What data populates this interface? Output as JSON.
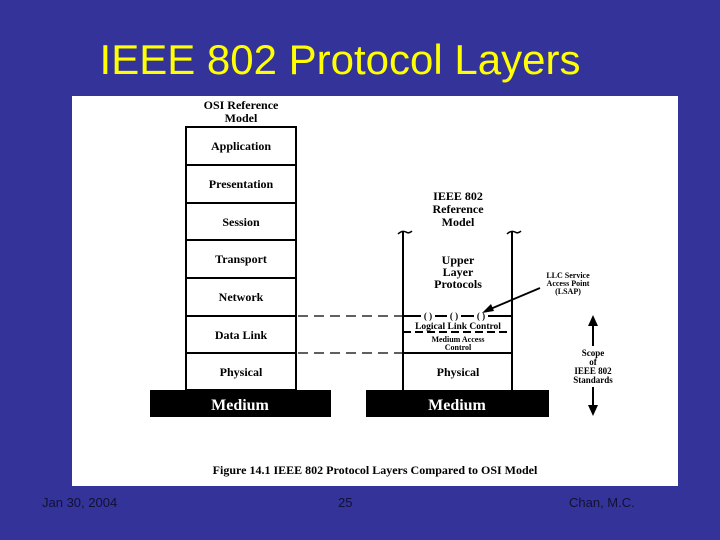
{
  "slide": {
    "title": "IEEE 802 Protocol Layers",
    "background_color": "#333399",
    "title_color": "#ffff00"
  },
  "figure": {
    "caption": "Figure 14.1  IEEE 802 Protocol Layers Compared to OSI Model",
    "osi": {
      "heading_line1": "OSI Reference",
      "heading_line2": "Model",
      "layers": [
        "Application",
        "Presentation",
        "Session",
        "Transport",
        "Network",
        "Data Link",
        "Physical"
      ],
      "medium": "Medium"
    },
    "ieee": {
      "heading_line1": "IEEE 802",
      "heading_line2": "Reference",
      "heading_line3": "Model",
      "upper_line1": "Upper",
      "upper_line2": "Layer",
      "upper_line3": "Protocols",
      "llc": "Logical Link Control",
      "mac_line1": "Medium Access",
      "mac_line2": "Control",
      "physical": "Physical",
      "medium": "Medium",
      "sap_symbols": [
        "( )",
        "( )",
        "( )"
      ]
    },
    "lsap_note": {
      "line1": "LLC Service",
      "line2": "Access Point",
      "line3": "(LSAP)"
    },
    "scope_note": {
      "line1": "Scope",
      "line2": "of",
      "line3": "IEEE 802",
      "line4": "Standards"
    }
  },
  "footer": {
    "date": "Jan 30, 2004",
    "page": "25",
    "author": "Chan, M.C."
  }
}
